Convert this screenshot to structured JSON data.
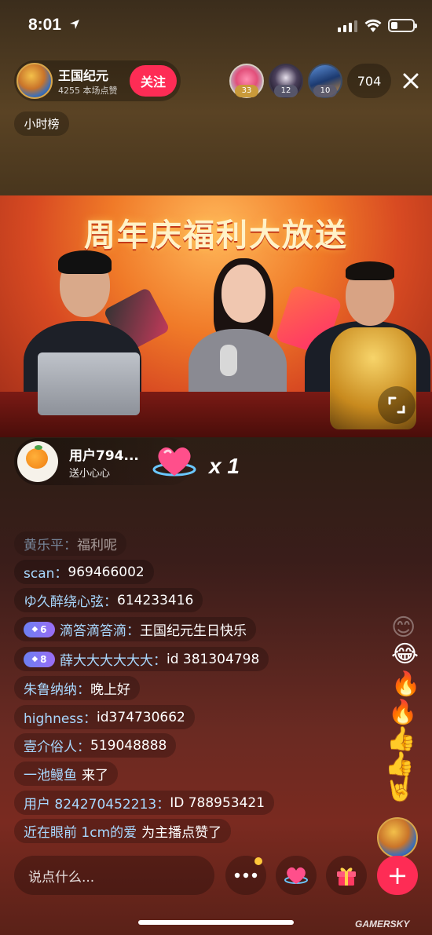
{
  "status_bar": {
    "time": "8:01"
  },
  "host": {
    "name": "王国纪元",
    "likes": "4255 本场点赞",
    "follow_label": "关注"
  },
  "top_viewers": [
    {
      "badge": "33"
    },
    {
      "badge": "12"
    },
    {
      "badge": "10"
    }
  ],
  "viewer_count": "704",
  "rank_label": "小时榜",
  "video": {
    "banner_text": "周年庆福利大放送"
  },
  "gift": {
    "user": "用户794...",
    "action": "送小心心",
    "count": "x 1"
  },
  "comments": [
    {
      "name": "黄乐平：",
      "text": "福利呢"
    },
    {
      "name": "scan：",
      "text": "969466002"
    },
    {
      "name": "ゆ久醉绕心弦：",
      "text": "614233416"
    },
    {
      "level": "6",
      "name": "滴答滴答滴：",
      "text": "王国纪元生日快乐"
    },
    {
      "level": "8",
      "name": "薛大大大大大大：",
      "text": "id 381304798"
    },
    {
      "name": "朱鲁纳纳：",
      "text": "晚上好"
    },
    {
      "name": "highness：",
      "text": "id374730662"
    },
    {
      "name": "壹介俗人：",
      "text": "519048888"
    },
    {
      "name": "一池鳗鱼",
      "text": "来了"
    },
    {
      "name": "用户 824270452213：",
      "text": "ID 788953421"
    },
    {
      "name": "近在眼前 1cm的爱",
      "text": "为主播点赞了"
    }
  ],
  "bottom_bar": {
    "input_placeholder": "说点什么...",
    "plus_label": "+"
  },
  "watermark": "GAMERSKY",
  "colors": {
    "accent": "#fe2c55",
    "comment_name": "#a8d8ff",
    "level_badge": "#7a78f3"
  }
}
